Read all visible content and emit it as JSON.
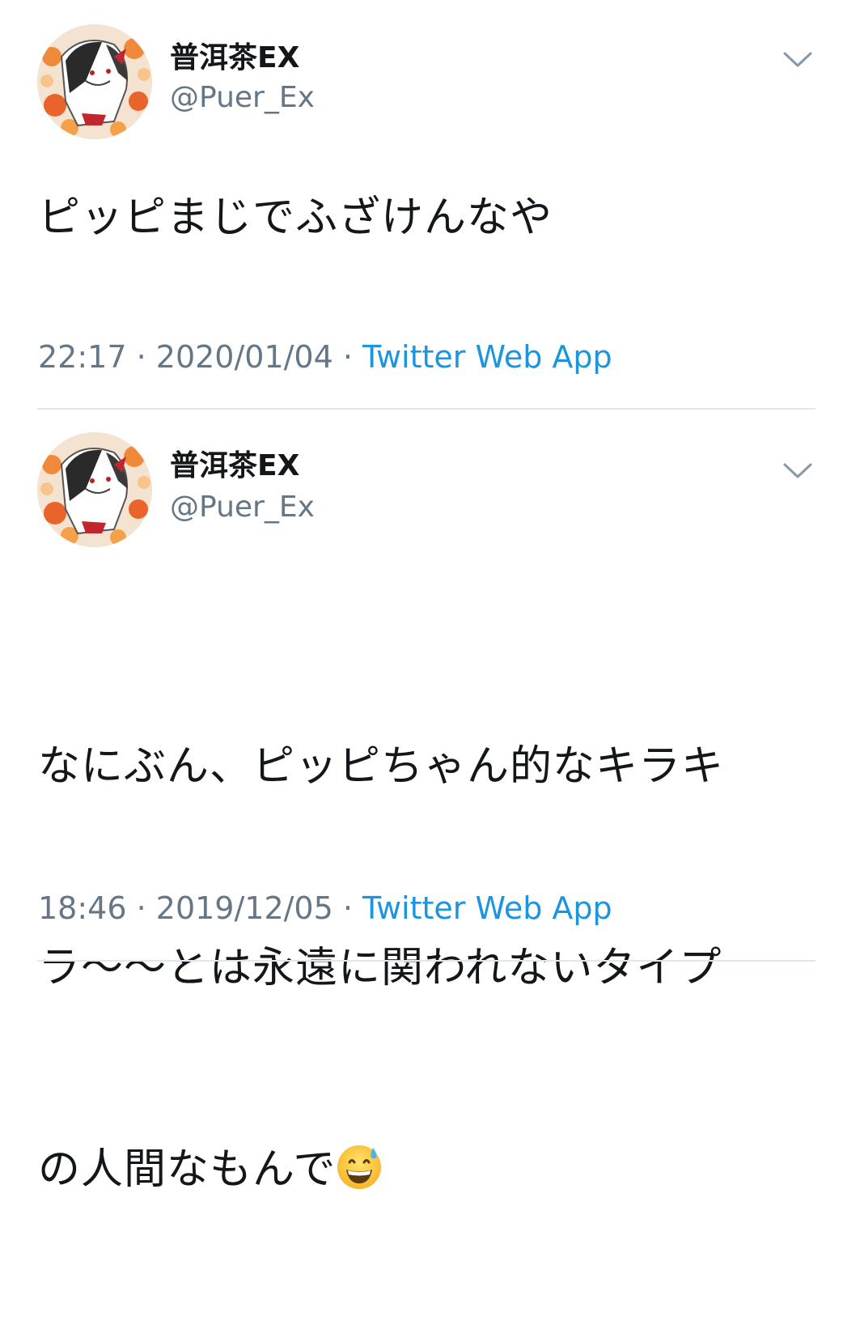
{
  "tweets": [
    {
      "display_name": "普洱茶EX",
      "handle": "@Puer_Ex",
      "text": "ピッピまじでふざけんなや",
      "time": "22:17",
      "date": "2020/01/04",
      "separator": " · ",
      "source": "Twitter Web App"
    },
    {
      "display_name": "普洱茶EX",
      "handle": "@Puer_Ex",
      "text_lines": [
        "なにぶん、ピッピちゃん的なキラキ",
        "ラ〜〜とは永遠に関われないタイプ",
        "の人間なもんで"
      ],
      "text_emoji": "grinning-face-with-sweat-emoji",
      "time": "18:46",
      "date": "2019/12/05",
      "separator": " · ",
      "source": "Twitter Web App"
    }
  ],
  "colors": {
    "name": "#14171a",
    "secondary": "#657786",
    "link": "#1b95e0",
    "divider": "#e1e8ed"
  },
  "icons": {
    "caret": "chevron-down-icon",
    "avatar": "avatar"
  }
}
